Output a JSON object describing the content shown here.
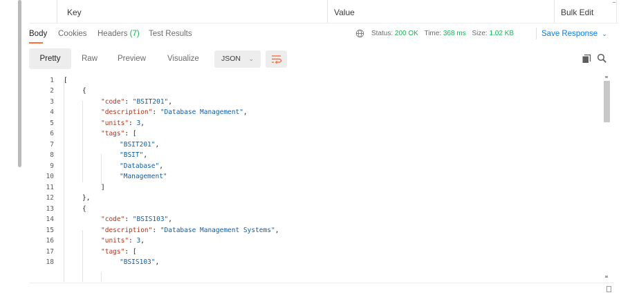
{
  "params_table": {
    "key_header": "Key",
    "value_header": "Value",
    "bulk_edit": "Bulk Edit"
  },
  "response_tabs": {
    "body": "Body",
    "cookies": "Cookies",
    "headers": "Headers",
    "headers_count": "(7)",
    "test_results": "Test Results"
  },
  "status": {
    "status_label": "Status:",
    "status_value": "200 OK",
    "time_label": "Time:",
    "time_value": "368 ms",
    "size_label": "Size:",
    "size_value": "1.02 KB",
    "save_response": "Save Response"
  },
  "view": {
    "pretty": "Pretty",
    "raw": "Raw",
    "preview": "Preview",
    "visualize": "Visualize",
    "format": "JSON"
  },
  "code_lines": [
    {
      "n": "1",
      "text": "["
    },
    {
      "n": "2",
      "text": "{"
    },
    {
      "n": "3",
      "key": "\"code\"",
      "val": "\"BSIT201\"",
      "tail": ","
    },
    {
      "n": "4",
      "key": "\"description\"",
      "val": "\"Database Management\"",
      "tail": ","
    },
    {
      "n": "5",
      "key": "\"units\"",
      "val": "3",
      "tail": ","
    },
    {
      "n": "6",
      "key": "\"tags\"",
      "val": "[",
      "tail": ""
    },
    {
      "n": "7",
      "val": "\"BSIT201\"",
      "tail": ","
    },
    {
      "n": "8",
      "val": "\"BSIT\"",
      "tail": ","
    },
    {
      "n": "9",
      "val": "\"Database\"",
      "tail": ","
    },
    {
      "n": "10",
      "val": "\"Management\"",
      "tail": ""
    },
    {
      "n": "11",
      "text": "]"
    },
    {
      "n": "12",
      "text": "},"
    },
    {
      "n": "13",
      "text": "{"
    },
    {
      "n": "14",
      "key": "\"code\"",
      "val": "\"BSIS103\"",
      "tail": ","
    },
    {
      "n": "15",
      "key": "\"description\"",
      "val": "\"Database Management Systems\"",
      "tail": ","
    },
    {
      "n": "16",
      "key": "\"units\"",
      "val": "3",
      "tail": ","
    },
    {
      "n": "17",
      "key": "\"tags\"",
      "val": "[",
      "tail": ""
    },
    {
      "n": "18",
      "val": "\"BSIS103\"",
      "tail": ","
    }
  ]
}
